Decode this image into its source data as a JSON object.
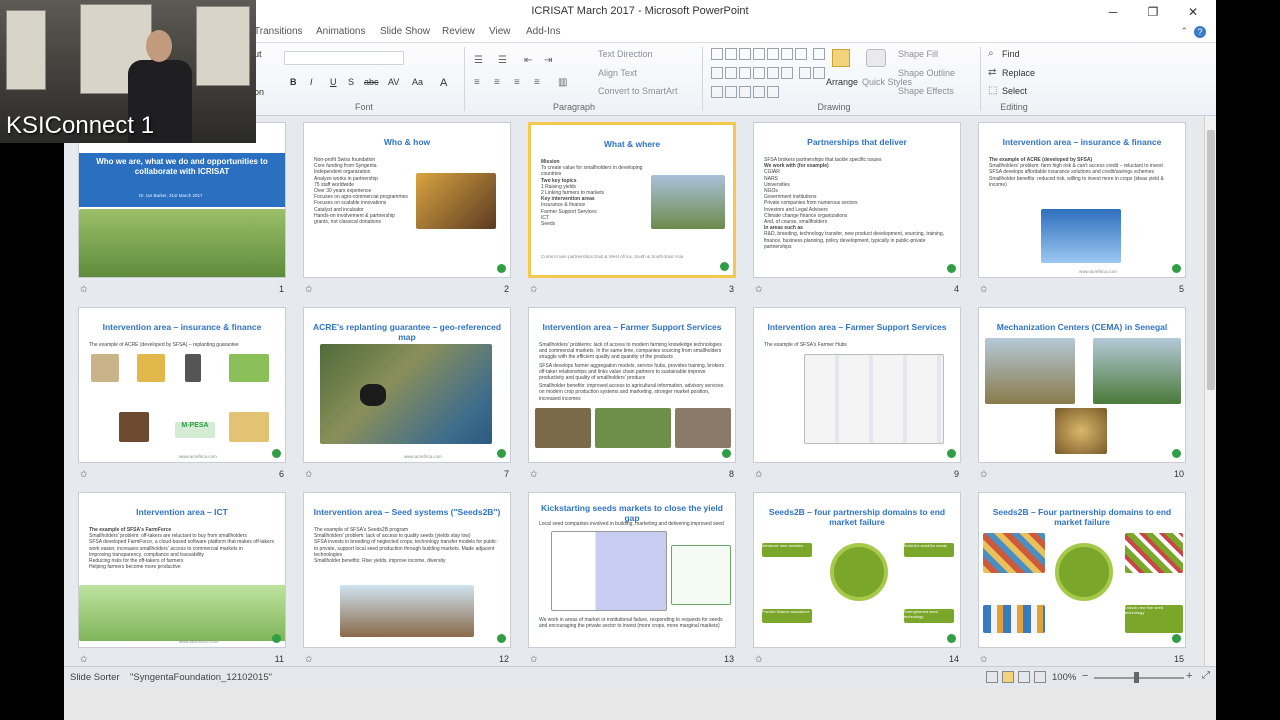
{
  "window": {
    "title": "ICRISAT March 2017  -  Microsoft PowerPoint",
    "minimize": "─",
    "restore": "❐",
    "close": "✕"
  },
  "ribbon_tabs": [
    "Transitions",
    "Animations",
    "Slide Show",
    "Review",
    "View",
    "Add-Ins"
  ],
  "ribbon": {
    "groups": [
      "Font",
      "Paragraph",
      "Drawing",
      "Editing"
    ],
    "paragraph_buttons": [
      "Text Direction",
      "Align Text",
      "Convert to SmartArt"
    ],
    "drawing_buttons": [
      "Arrange",
      "Quick Styles",
      "Shape Fill",
      "Shape Outline",
      "Shape Effects"
    ],
    "editing_buttons": [
      "Find",
      "Replace",
      "Select"
    ],
    "font_buttons": [
      "B",
      "I",
      "U",
      "S",
      "abc",
      "AV",
      "Aa",
      "A"
    ],
    "cut_label": "ut",
    "on_label": "on"
  },
  "slides": [
    {
      "num": "1",
      "title": "Who we are, what we do and opportunities to collaborate with ICRISAT",
      "subtitle": "Dr. Ian Barker, 31st March 2017",
      "body": []
    },
    {
      "num": "2",
      "title": "Who & how",
      "body": [
        "Non-profit Swiss foundation",
        "Core funding from Syngenta",
        "Independent organization",
        "Analyze works in partnership",
        "75 staff worldwide",
        "Over 30 years experience",
        "Focuses on agro-commercial programmes",
        "Focuses on scalable innovations",
        "Catalyst and incubator",
        "Hands-on involvement & partnership grants, not classical donations"
      ]
    },
    {
      "num": "3",
      "title": "What & where",
      "body": [
        "Mission",
        "To create value for smallholders in developing countries",
        "Two key topics",
        "1  Raising yields",
        "2  Linking farmers to markets",
        "Key intervention areas",
        "Insurance & finance",
        "Farmer Support Services",
        "ICT",
        "Seeds",
        "Current main partnerships East & West Africa, South & South-East Asia"
      ]
    },
    {
      "num": "4",
      "title": "Partnerships that deliver",
      "body": [
        "SFSA brokers partnerships that tackle specific issues",
        "We work with (for example)",
        "CGIAR",
        "NARS",
        "Universities",
        "NGOs",
        "Government institutions",
        "Private companies from numerous sectors",
        "Investors and Legal Advisers",
        "Climate change finance organizations",
        "And, of course, smallholders",
        "In areas such as",
        "R&D, breeding, technology transfer, new product development, sourcing, training, finance, business planning, policy development, typically in public-private partnerships"
      ]
    },
    {
      "num": "5",
      "title": "Intervention area – insurance & finance",
      "body": [
        "The example of ACRE (developed by SFSA)",
        "Smallholders' problem: farm high risk & can't access credit – reluctant to invest",
        "SFSA develops affordable insurance solutions and credit/savings schemes",
        "Smallholder benefits: reduced risk, willing to invest more in crops (ideas yield & income)"
      ],
      "footer": "www.acrefrica.com"
    },
    {
      "num": "6",
      "title": "Intervention area – insurance & finance",
      "body": [
        "The example of ACRE (developed by SFSA) – replanting guarantee"
      ],
      "footer": "www.acrefrica.com"
    },
    {
      "num": "7",
      "title": "ACRE's replanting guarantee – geo-referenced map",
      "body": [],
      "footer": "www.acrefrica.com"
    },
    {
      "num": "8",
      "title": "Intervention area – Farmer Support Services",
      "body": [
        "Smallholders' problems: lack of access to modern farming knowledge technologies and commercial markets. In the same time, companies sourcing from smallholders struggle with the efficient quality and quantity of the products",
        "SFSA develops farmer aggregation models, service hubs, provides training, brokers off-taker relationships and links value chain partners to sustainable improve productivity and quality of smallholders' produce",
        "Smallholder benefits: improved access to agricultural information, advisory services on modern crop production systems and marketing, stronger market position, increased incomes"
      ]
    },
    {
      "num": "9",
      "title": "Intervention area – Farmer Support Services",
      "body": [
        "The example of SFSA's Farmer Hubs"
      ]
    },
    {
      "num": "10",
      "title": "Mechanization Centers (CEMA) in Senegal",
      "body": []
    },
    {
      "num": "11",
      "title": "Intervention area – ICT",
      "body": [
        "The example of SFSA's FarmForce",
        "Smallholders' problem: off-takers are reluctant to buy from smallholders",
        "SFSA developed FarmForce, a cloud-based software platform that makes off-takers work easier, increases smallholders' access to commercial markets in",
        "Improving transparency, compliance and traceability",
        "Reducing risks for the off-takers of farmers",
        "Helping farmers become more productive"
      ],
      "footer": "www.farmforce.com"
    },
    {
      "num": "12",
      "title": "Intervention area – Seed systems (\"Seeds2B\")",
      "body": [
        "The example of SFSA's Seeds2B program",
        "Smallholders' problem: lack of access to quality seeds (yields stay low)",
        "SFSA invests in breeding of neglected crops, technology transfer models for public to private, support local seed production through building markets. Made adjacent technologies",
        "Smallholder benefits: Rise yields, improve income, diversity"
      ]
    },
    {
      "num": "13",
      "title": "Kickstarting seeds markets to close the yield gap",
      "body": [
        "Local seed companies involved in building, marketing and delivering improved seed",
        "We work in areas of market or institutional failure, responding to requests for seeds and encouraging the private sector to invest (more crops, more marginal markets)"
      ]
    },
    {
      "num": "14",
      "title": "Seeds2B – four partnership domains to end market failure",
      "body": [
        "Introduce new varieties",
        "Build the seed/for seeds",
        "Provide finance assistance",
        "Strengthened seed technology"
      ]
    },
    {
      "num": "15",
      "title": "Seeds2B – Four partnership domains to end market failure",
      "body": [
        "Introduce new varieties",
        "Build the seed/for seeds",
        "Provide finance assistance",
        "Unlock new fine seed technology"
      ]
    }
  ],
  "status": {
    "view": "Slide Sorter",
    "theme": "\"SyngentaFoundation_12102015\"",
    "zoom": "100%",
    "zoom_minus": "−",
    "zoom_plus": "+"
  },
  "webcam": {
    "label": "KSIConnect 1"
  },
  "colors": {
    "slide_title": "#2f73c6",
    "selected_border": "#f2c94c",
    "logo_green": "#2f9e44"
  }
}
